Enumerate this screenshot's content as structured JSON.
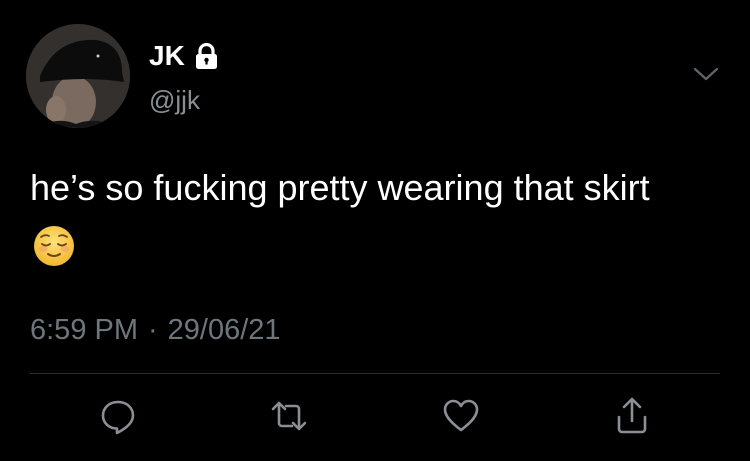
{
  "author": {
    "display_name": "JK",
    "handle": "@jjk",
    "protected": true,
    "avatar_icon": "profile-photo"
  },
  "tweet": {
    "text": "he’s so fucking pretty wearing that skirt",
    "emoji": "relieved-face",
    "time": "6:59 PM",
    "separator": "·",
    "date": "29/06/21"
  },
  "actions": [
    {
      "icon": "reply-icon"
    },
    {
      "icon": "retweet-icon"
    },
    {
      "icon": "like-icon"
    },
    {
      "icon": "share-icon"
    }
  ],
  "colors": {
    "background": "#000000",
    "primary_text": "#ffffff",
    "secondary_text": "#6e767d",
    "icon_gray": "#8b8f94",
    "divider": "#2a2d30",
    "emoji_yellow": "#f7c948"
  }
}
